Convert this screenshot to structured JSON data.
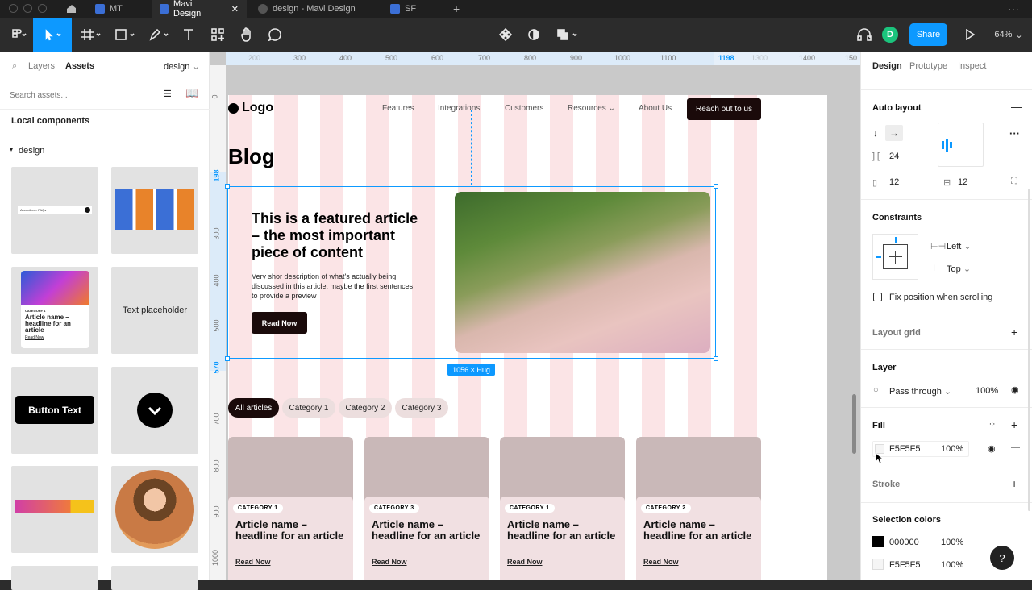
{
  "tabs": [
    {
      "label": "MT"
    },
    {
      "label": "Mavi Design"
    },
    {
      "label": "design - Mavi Design"
    },
    {
      "label": "SF"
    }
  ],
  "toolbar": {
    "share": "Share",
    "zoom": "64%",
    "avatar": "D"
  },
  "left": {
    "tab_layers": "Layers",
    "tab_assets": "Assets",
    "page": "design",
    "search_placeholder": "Search assets...",
    "local": "Local components",
    "group": "design",
    "thumbs": {
      "accordion": "Accordion – FAQs",
      "text_placeholder": "Text placeholder",
      "button_text": "Button Text",
      "category": "CATEGORY 1",
      "article": "Article name – headline for an article",
      "read": "Read Now"
    }
  },
  "ruler": {
    "top": [
      "200",
      "300",
      "400",
      "500",
      "600",
      "700",
      "800",
      "900",
      "1000",
      "1100",
      "1198",
      "1300",
      "1400",
      "150"
    ],
    "left": [
      "0",
      "198",
      "300",
      "400",
      "500",
      "570",
      "700",
      "800",
      "900",
      "1000"
    ]
  },
  "design": {
    "logo": "Logo",
    "nav": [
      "Features",
      "Integrations",
      "Customers",
      "Resources",
      "About Us"
    ],
    "cta": "Reach out to us",
    "blog": "Blog",
    "featured_title": "This is a featured article – the most important piece of content",
    "featured_desc": "Very shor description of what's actually being discussed  in this article, maybe the first sentences to provide a preview",
    "read_now": "Read Now",
    "size_badge": "1056 × Hug",
    "pills": [
      "All articles",
      "Category 1",
      "Category 2",
      "Category 3"
    ],
    "cards": [
      {
        "cat": "CATEGORY 1",
        "title": "Article name – headline for an article",
        "link": "Read Now"
      },
      {
        "cat": "CATEGORY 3",
        "title": "Article name – headline for an article",
        "link": "Read Now"
      },
      {
        "cat": "CATEGORY 1",
        "title": "Article name – headline for an article",
        "link": "Read Now"
      },
      {
        "cat": "CATEGORY 2",
        "title": "Article name – headline for an article",
        "link": "Read Now"
      }
    ]
  },
  "right": {
    "tabs": [
      "Design",
      "Prototype",
      "Inspect"
    ],
    "auto_layout": "Auto layout",
    "spacing": "24",
    "pad_h": "12",
    "pad_v": "12",
    "constraints": "Constraints",
    "c_h": "Left",
    "c_v": "Top",
    "fix": "Fix position when scrolling",
    "layout_grid": "Layout grid",
    "layer": "Layer",
    "blend": "Pass through",
    "opacity": "100%",
    "fill": "Fill",
    "fill_hex": "F5F5F5",
    "fill_op": "100%",
    "stroke": "Stroke",
    "selection_colors": "Selection colors",
    "sel": [
      {
        "hex": "000000",
        "op": "100%",
        "color": "#000000"
      },
      {
        "hex": "F5F5F5",
        "op": "100%",
        "color": "#F5F5F5"
      }
    ],
    "help": "?"
  },
  "colors": {
    "accent": "#0d99ff",
    "dark": "#1a0a0a",
    "grid": "#f09aa0"
  }
}
